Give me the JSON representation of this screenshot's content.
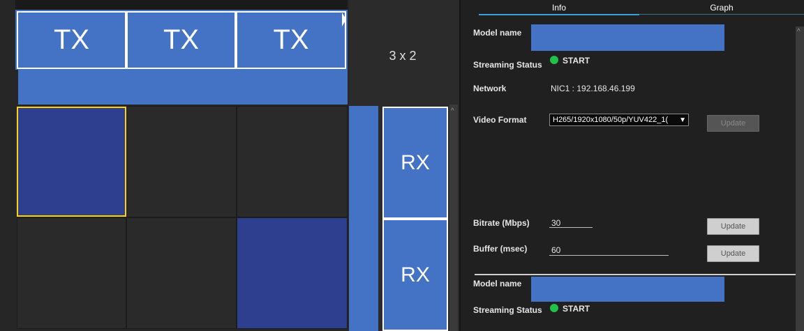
{
  "matrix": {
    "tx_labels": [
      "TX",
      "TX",
      "TX"
    ],
    "layout": "3 x 2",
    "rx_labels": [
      "RX",
      "RX"
    ]
  },
  "tabs": [
    "Info",
    "Graph"
  ],
  "device1": {
    "model_label": "Model name",
    "status_label": "Streaming Status",
    "status_value": "START",
    "network_label": "Network",
    "network_value": "NIC1 : 192.168.46.199",
    "video_label": "Video Format",
    "video_value": "H265/1920x1080/50p/YUV422_1(",
    "update_label": "Update",
    "bitrate_label": "Bitrate (Mbps)",
    "bitrate_value": "30",
    "buffer_label": "Buffer (msec)",
    "buffer_value": "60"
  },
  "device2": {
    "model_label": "Model name",
    "status_label": "Streaming Status",
    "status_value": "START"
  },
  "colors": {
    "accent_blue": "#4472c4",
    "selected_border": "#ffd400",
    "status_green": "#21c04a",
    "tab_active": "#3aa0e0"
  }
}
